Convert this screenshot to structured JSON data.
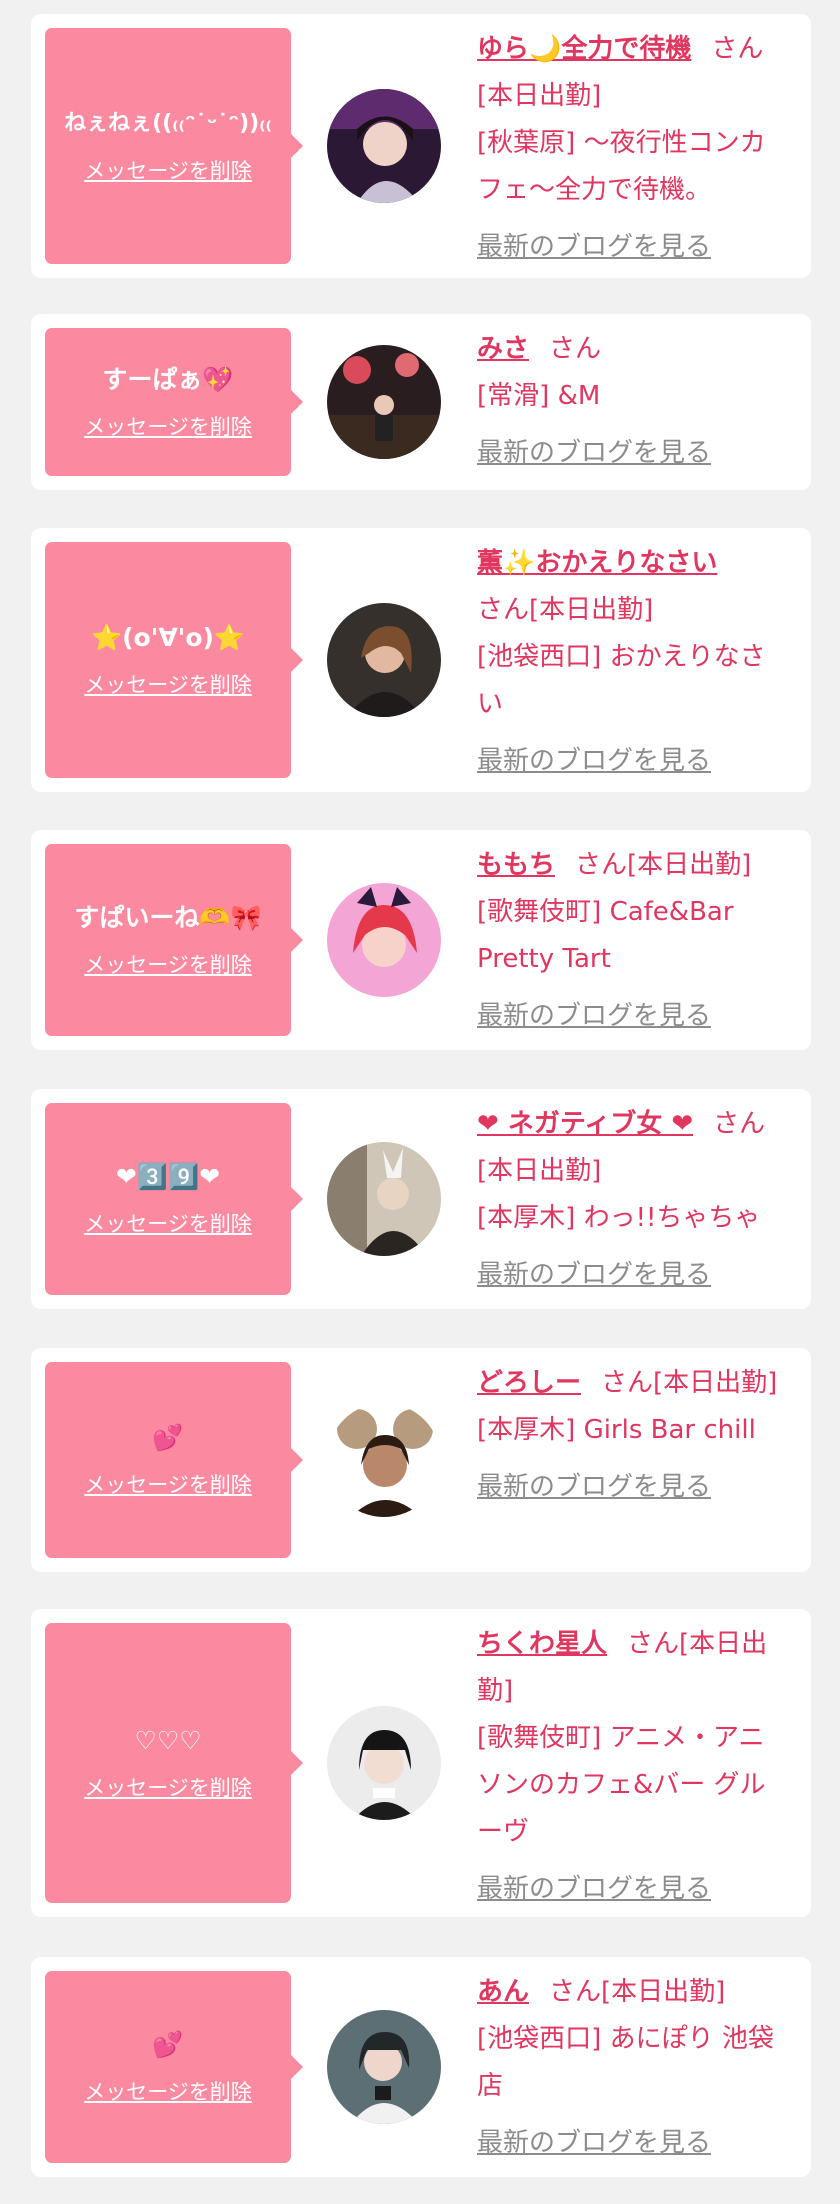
{
  "delete_label": "メッセージを削除",
  "blog_label": "最新のブログを見る",
  "cards": [
    {
      "message": "ねぇねぇ((₍₍ᵔ˙ᵕ˙ᵔ))₍₍",
      "name": "ゆら🌙全力で待機",
      "honorific": "さん",
      "status": "[本日出勤]",
      "area": "[秋葉原]",
      "shop": "〜夜行性コンカフェ〜全力で待機。"
    },
    {
      "message": "すーぱぁ💖",
      "name": "みさ",
      "honorific": "さん",
      "status": "",
      "area": "[常滑]",
      "shop": "&M"
    },
    {
      "message": "⭐(o'∀'o)⭐",
      "name": "薫✨おかえりなさい",
      "honorific": "さん",
      "status": "[本日出勤]",
      "area": "[池袋西口]",
      "shop": "おかえりなさい"
    },
    {
      "message": "すぱいーね🫶🎀",
      "name": "ももち",
      "honorific": "さん",
      "status": "[本日出勤]",
      "area": "[歌舞伎町]",
      "shop": "Cafe&Bar Pretty Tart"
    },
    {
      "message": "❤3️⃣9️⃣❤",
      "name": "❤ ネガティブ女 ❤",
      "honorific": "さん",
      "status": "[本日出勤]",
      "area": "[本厚木]",
      "shop": "わっ!!ちゃちゃ"
    },
    {
      "message": "💕",
      "name": "どろしー",
      "honorific": "さん",
      "status": "[本日出勤]",
      "area": "[本厚木]",
      "shop": "Girls Bar chill"
    },
    {
      "message": "♡♡♡",
      "name": "ちくわ星人",
      "honorific": "さん",
      "status": "[本日出勤]",
      "area": "[歌舞伎町]",
      "shop": "アニメ・アニソンのカフェ&バー グルーヴ"
    },
    {
      "message": "💕",
      "name": "あん",
      "honorific": "さん",
      "status": "[本日出勤]",
      "area": "[池袋西口]",
      "shop": "あにぽり 池袋店"
    }
  ],
  "colors": {
    "page_bg": "#f1f1f1",
    "bubble": "#fb8aa1",
    "name": "#e0365f",
    "blog_link": "#8c8c8c"
  },
  "avatar_icons": [
    "avatar-photo-icon",
    "avatar-photo-icon",
    "avatar-photo-icon",
    "avatar-photo-icon",
    "avatar-photo-icon",
    "avatar-photo-icon",
    "avatar-photo-icon",
    "avatar-photo-icon"
  ]
}
